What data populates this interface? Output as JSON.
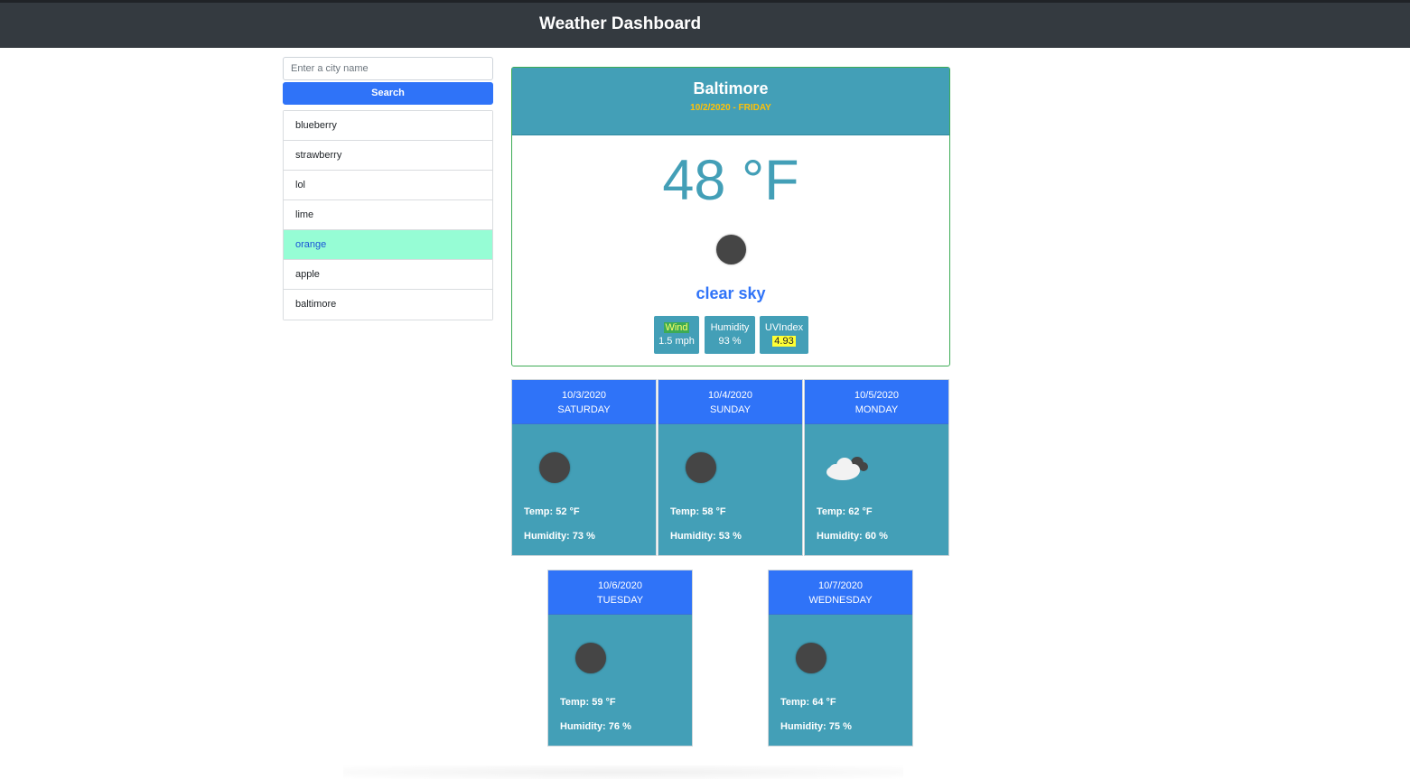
{
  "header": {
    "title": "Weather Dashboard"
  },
  "search": {
    "placeholder": "Enter a city name",
    "button_label": "Search"
  },
  "cities": [
    {
      "name": "blueberry",
      "active": false
    },
    {
      "name": "strawberry",
      "active": false
    },
    {
      "name": "lol",
      "active": false
    },
    {
      "name": "lime",
      "active": false
    },
    {
      "name": "orange",
      "active": true
    },
    {
      "name": "apple",
      "active": false
    },
    {
      "name": "baltimore",
      "active": false
    }
  ],
  "current": {
    "city": "Baltimore",
    "date": "10/2/2020 - FRIDAY",
    "temp": "48 °F",
    "icon": "sun-icon",
    "description": "clear sky",
    "wind": {
      "label": "Wind",
      "value": "1.5 mph"
    },
    "humidity": {
      "label": "Humidity",
      "value": "93 %"
    },
    "uv": {
      "label": "UVIndex",
      "value": "4.93"
    }
  },
  "forecast": [
    {
      "date": "10/3/2020",
      "day": "SATURDAY",
      "icon": "sun-icon",
      "temp": "Temp: 52 °F",
      "humidity": "Humidity: 73 %"
    },
    {
      "date": "10/4/2020",
      "day": "SUNDAY",
      "icon": "sun-icon",
      "temp": "Temp: 58 °F",
      "humidity": "Humidity: 53 %"
    },
    {
      "date": "10/5/2020",
      "day": "MONDAY",
      "icon": "cloud-icon",
      "temp": "Temp: 62 °F",
      "humidity": "Humidity: 60 %"
    },
    {
      "date": "10/6/2020",
      "day": "TUESDAY",
      "icon": "sun-icon",
      "temp": "Temp: 59 °F",
      "humidity": "Humidity: 76 %"
    },
    {
      "date": "10/7/2020",
      "day": "WEDNESDAY",
      "icon": "sun-icon",
      "temp": "Temp: 64 °F",
      "humidity": "Humidity: 75 %"
    }
  ],
  "colors": {
    "navbar": "#343a40",
    "primary": "#2f73f8",
    "info": "#439fb7",
    "active_item": "#96fdd5",
    "date_accent": "#ffc107",
    "uv_highlight": "#ffff33"
  }
}
